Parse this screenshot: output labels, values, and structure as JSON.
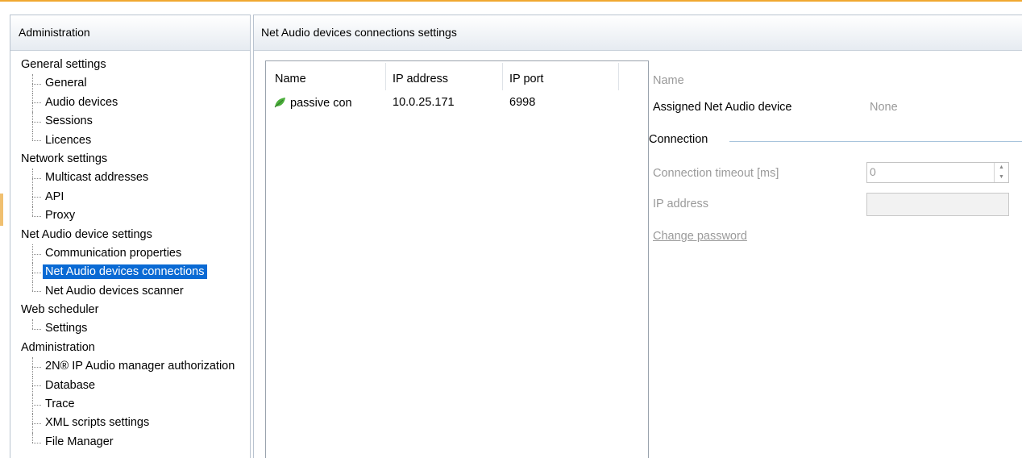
{
  "left_panel": {
    "header": "Administration",
    "groups": [
      {
        "label": "General settings",
        "items": [
          "General",
          "Audio devices",
          "Sessions",
          "Licences"
        ]
      },
      {
        "label": "Network settings",
        "items": [
          "Multicast addresses",
          "API",
          "Proxy"
        ]
      },
      {
        "label": "Net Audio device settings",
        "items": [
          "Communication properties",
          "Net Audio devices connections",
          "Net Audio devices scanner"
        ]
      },
      {
        "label": "Web scheduler",
        "items": [
          "Settings"
        ]
      },
      {
        "label": "Administration",
        "items": [
          "2N® IP Audio manager authorization",
          "Database",
          "Trace",
          "XML scripts settings",
          "File Manager"
        ]
      }
    ],
    "selected_item": "Net Audio devices connections"
  },
  "right_panel": {
    "header": "Net Audio devices connections settings",
    "table": {
      "columns": [
        "Name",
        "IP address",
        "IP port"
      ],
      "rows": [
        {
          "icon": "leaf-icon",
          "name": "passive con",
          "ip": "10.0.25.171",
          "port": "6998"
        }
      ]
    },
    "details": {
      "name_label": "Name",
      "assigned_label": "Assigned Net Audio device",
      "assigned_value": "None",
      "connection_section": "Connection",
      "timeout_label": "Connection timeout [ms]",
      "timeout_value": "0",
      "ip_label": "IP address",
      "ip_value": "",
      "change_password": "Change password"
    }
  },
  "colors": {
    "selection": "#0a6ad4",
    "window_accent": "#f0a830",
    "icon_green": "#4caf3c"
  }
}
